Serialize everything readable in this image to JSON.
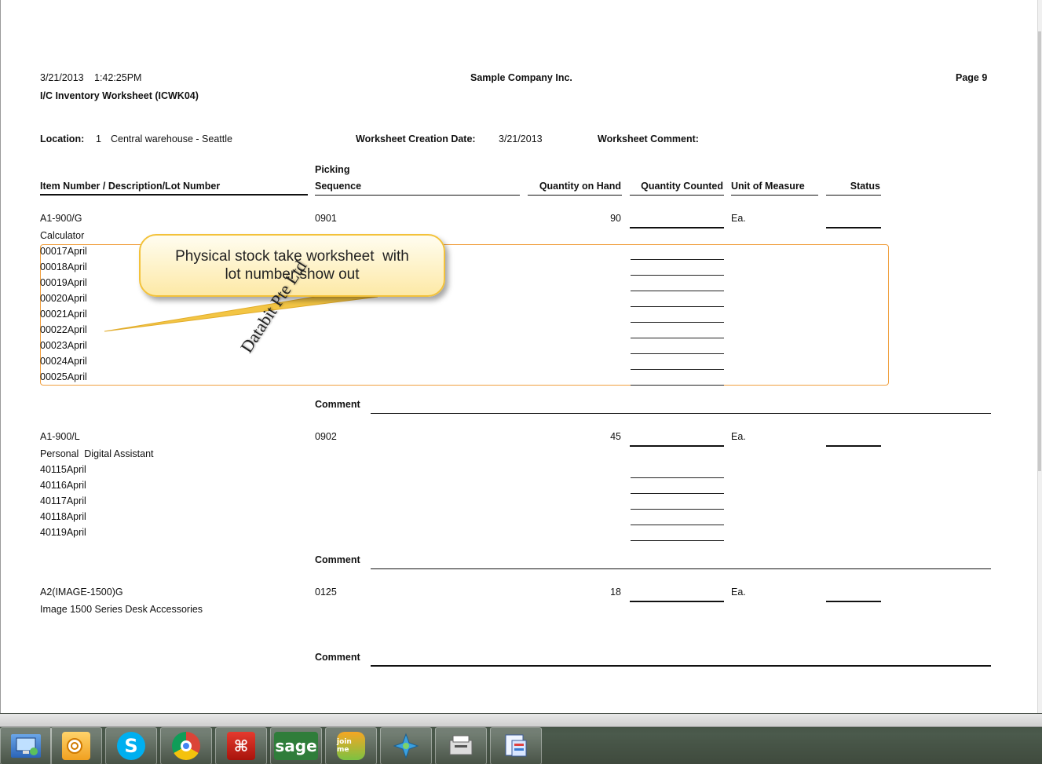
{
  "report": {
    "date": "3/21/2013",
    "time": "1:42:25PM",
    "company": "Sample Company Inc.",
    "page": "Page 9",
    "title": "I/C Inventory Worksheet (ICWK04)"
  },
  "filters": {
    "location_label": "Location:",
    "location_code": "1",
    "location_name": "Central warehouse - Seattle",
    "creation_date_label": "Worksheet Creation Date:",
    "creation_date": "3/21/2013",
    "comment_label": "Worksheet Comment:"
  },
  "columns": {
    "item": "Item Number / Description/Lot Number",
    "picking_top": "Picking",
    "picking_bottom": "Sequence",
    "qty_on_hand": "Quantity on Hand",
    "qty_counted": "Quantity Counted",
    "uom": "Unit of Measure",
    "status": "Status"
  },
  "items": [
    {
      "number": "A1-900/G",
      "description": "Calculator",
      "sequence": "0901",
      "qty_on_hand": "90",
      "uom": "Ea.",
      "lots": [
        "00017April",
        "00018April",
        "00019April",
        "00020April",
        "00021April",
        "00022April",
        "00023April",
        "00024April",
        "00025April"
      ],
      "comment_label": "Comment"
    },
    {
      "number": "A1-900/L",
      "description": "Personal  Digital Assistant",
      "sequence": "0902",
      "qty_on_hand": "45",
      "uom": "Ea.",
      "lots": [
        "40115April",
        "40116April",
        "40117April",
        "40118April",
        "40119April"
      ],
      "comment_label": "Comment"
    },
    {
      "number": "A2(IMAGE-1500)G",
      "description": "Image 1500 Series Desk Accessories",
      "sequence": "0125",
      "qty_on_hand": "18",
      "uom": "Ea.",
      "comment_label": "Comment"
    }
  ],
  "callout": {
    "line1": "Physical stock take worksheet  with",
    "line2": "lot number show out"
  },
  "watermark": "Databit Pte Ltd",
  "taskbar": {
    "apps": [
      "remote-desktop-icon",
      "outlook-icon",
      "skype-icon",
      "chrome-icon",
      "acrobat-icon",
      "sage-icon",
      "joinme-icon",
      "star-app-icon",
      "scanner-icon",
      "document-viewer-icon"
    ],
    "sage_label": "sage",
    "joinme_label": "join me"
  },
  "colors": {
    "lot_box_border": "#f0a040",
    "callout_border": "#f3c23a",
    "callout_fill": "#fde9a6"
  }
}
